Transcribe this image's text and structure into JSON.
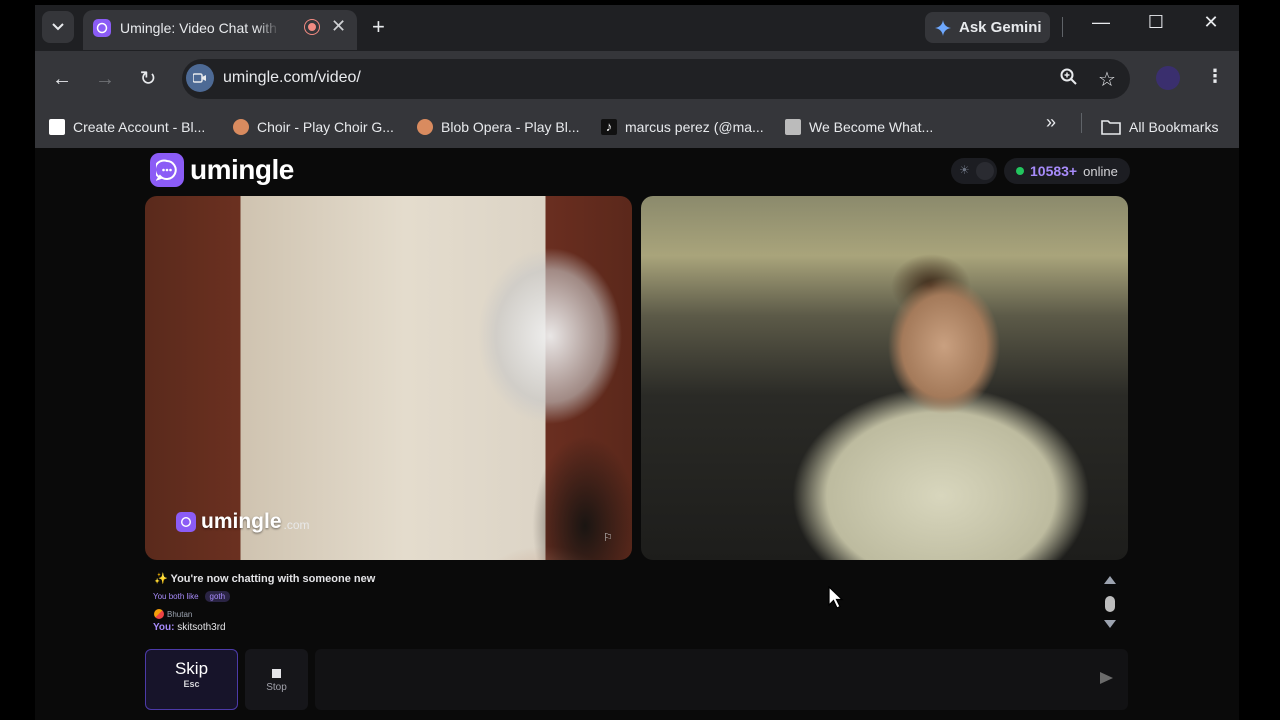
{
  "browser": {
    "tab": {
      "title": "Umingle: Video Chat with Strangers"
    },
    "gemini_label": "Ask Gemini",
    "url": "umingle.com/video/",
    "bookmarks": [
      {
        "label": "Create Account - Bl..."
      },
      {
        "label": "Choir - Play Choir G..."
      },
      {
        "label": "Blob Opera - Play Bl..."
      },
      {
        "label": "marcus perez (@ma..."
      },
      {
        "label": "We Become What..."
      }
    ],
    "all_bookmarks_label": "All Bookmarks",
    "icons": [
      "chevron-down-icon",
      "plus-icon",
      "minimize-icon",
      "maximize-icon",
      "close-icon",
      "back-icon",
      "forward-icon",
      "reload-icon",
      "zoom-icon",
      "star-icon",
      "menu-icon",
      "folder-icon"
    ]
  },
  "app": {
    "logo_text": "umingle",
    "online_count": "10583+",
    "online_label": "online",
    "watermark": {
      "name": "umingle",
      "suffix": ".com"
    },
    "accent": "#8b5cf6"
  },
  "chat": {
    "system_message": "✨ You're now chatting with someone new",
    "common_label": "You both like",
    "common_interest": "goth",
    "country": "Bhutan",
    "you_label": "You:",
    "you_message": "skitsoth3rd"
  },
  "controls": {
    "skip_label": "Skip",
    "skip_key": "Esc",
    "stop_label": "Stop"
  }
}
